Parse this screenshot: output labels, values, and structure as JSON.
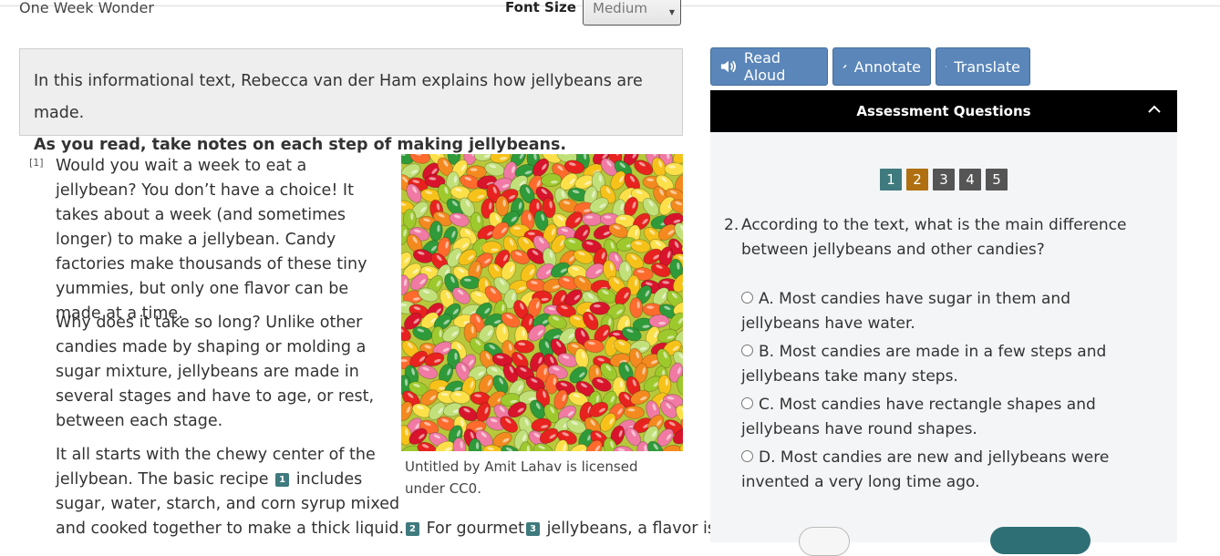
{
  "header": {
    "title": "One Week Wonder",
    "font_size_label": "Font Size",
    "font_size_value": "Medium"
  },
  "intro": {
    "line1": "In this informational text, Rebecca van der Ham explains how jellybeans are made.",
    "line2": "As you read, take notes on each step of making jellybeans."
  },
  "article": {
    "para_number": "[1]",
    "p1": "Would you wait a week to eat a jellybean? You don’t have a choice! It takes about a week (and sometimes longer) to make a jellybean. Candy factories make thousands of these tiny yummies, but only one flavor can be made at a time.",
    "p2": "Why does it take so long? Unlike other candies made by shaping or molding a sugar mixture, jellybeans are made in several stages and have to age, or rest, between each stage.",
    "p3_before": "It all starts with the chewy center of the jellybean. The basic recipe",
    "p3_gloss1": "1",
    "p3_after": "includes sugar, water, starch, and corn syrup mixed",
    "p3_cont": "and cooked together to make a thick liquid.",
    "gloss2": "2",
    "p3_cont2": "For gourmet",
    "gloss3": "3",
    "p3_cont3": "jellybeans, a flavor is"
  },
  "image": {
    "caption": "Untitled by Amit Lahav is licensed under CC0."
  },
  "tools": {
    "read_aloud": "Read Aloud",
    "annotate": "Annotate",
    "translate": "Translate"
  },
  "assessment": {
    "header": "Assessment Questions",
    "nav": [
      "1",
      "2",
      "3",
      "4",
      "5"
    ],
    "question_number": "2.",
    "question_text": "According to the text, what is the main difference between jellybeans and other candies?",
    "options": [
      "A. Most candies have sugar in them and jellybeans have water.",
      "B. Most candies are made in a few steps and jellybeans take many steps.",
      "C. Most candies have rectangle shapes and jellybeans have round shapes.",
      "D. Most candies are new and jellybeans were invented a very long time ago."
    ]
  },
  "colors": {
    "tool_button": "#5a86b9",
    "nav_done": "#3f7a7e",
    "nav_current": "#b06f10",
    "nav_pending": "#555555"
  },
  "icons": [
    "speaker-icon",
    "pen-icon",
    "globe-icon",
    "chevron-up-icon",
    "caret-down-icon"
  ]
}
